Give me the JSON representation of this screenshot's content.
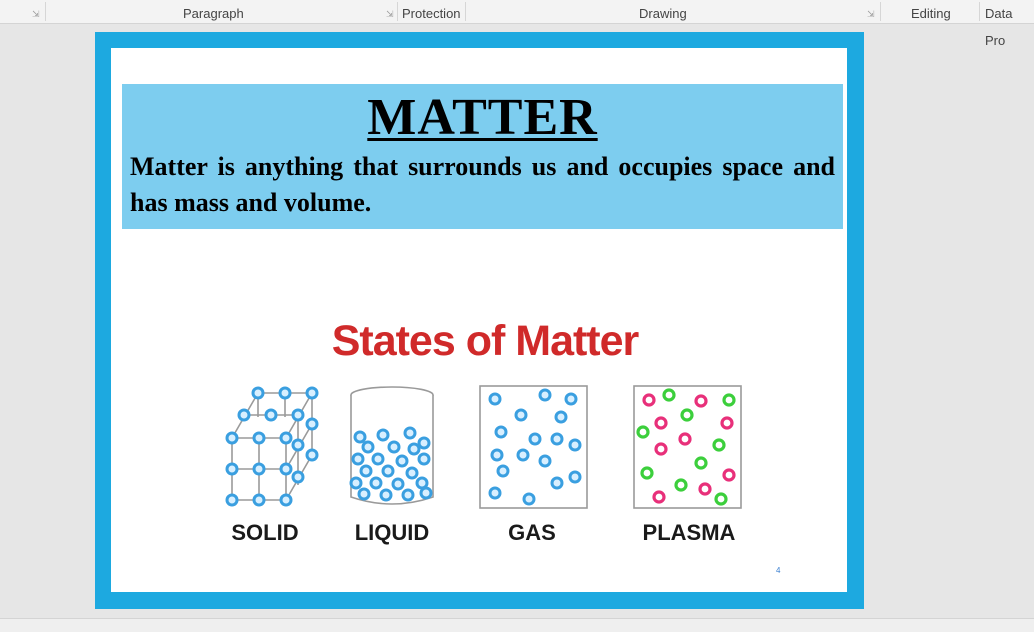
{
  "ribbon": {
    "groups": {
      "paragraph": "Paragraph",
      "protection": "Protection",
      "drawing": "Drawing",
      "editing": "Editing",
      "data_pro": "Data Pro"
    }
  },
  "slide": {
    "title": "MATTER",
    "body": "Matter is anything that surrounds us and occupies space and has mass and volume.",
    "states_title": "States of Matter",
    "states": {
      "solid": "SOLID",
      "liquid": "LIQUID",
      "gas": "GAS",
      "plasma": "PLASMA"
    },
    "slide_number": "4"
  },
  "colors": {
    "frame": "#1da9e0",
    "banner": "#7dcdef",
    "states_title": "#d02a2a",
    "particle_blue": "#3a9fe0",
    "plasma_pink": "#e8307a",
    "plasma_green": "#3ccf3c"
  }
}
